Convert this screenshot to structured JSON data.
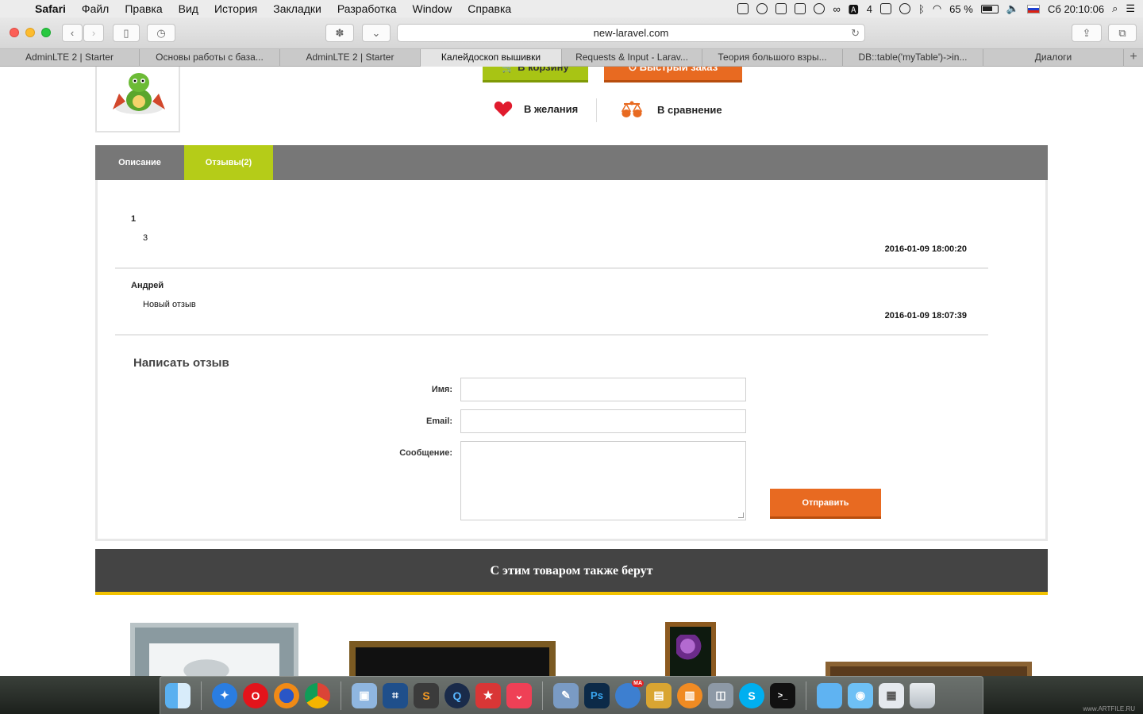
{
  "menubar": {
    "app": "Safari",
    "items": [
      "Файл",
      "Правка",
      "Вид",
      "История",
      "Закладки",
      "Разработка",
      "Window",
      "Справка"
    ],
    "status": {
      "num": "4",
      "battery": "65 %",
      "clock": "Сб 20:10:06"
    }
  },
  "browser": {
    "address": "new-laravel.com",
    "tabs": [
      {
        "label": "AdminLTE 2 | Starter"
      },
      {
        "label": "Основы работы с база..."
      },
      {
        "label": "AdminLTE 2 | Starter"
      },
      {
        "label": "Калейдоскоп вышивки"
      },
      {
        "label": "Requests & Input - Larav..."
      },
      {
        "label": "Теория большого взры..."
      },
      {
        "label": "DB::table('myTable')->in..."
      },
      {
        "label": "Диалоги"
      }
    ],
    "add_tab": "+"
  },
  "product": {
    "cart_button": "В корзину",
    "quick_order_button": "Быстрый заказ",
    "wishlist": "В желания",
    "compare": "В сравнение"
  },
  "product_tabs": {
    "description": "Описание",
    "reviews": "Отзывы(2)"
  },
  "reviews": [
    {
      "author": "1",
      "text": "3",
      "date": "2016-01-09 18:00:20"
    },
    {
      "author": "Андрей",
      "text": "Новый отзыв",
      "date": "2016-01-09 18:07:39"
    }
  ],
  "review_form": {
    "title": "Написать отзыв",
    "name_label": "Имя:",
    "email_label": "Email:",
    "message_label": "Сообщение:",
    "name_value": "",
    "email_value": "",
    "message_value": "",
    "submit": "Отправить"
  },
  "also_bought": {
    "title": "С этим товаром также берут"
  },
  "dock": {
    "apps": [
      "finder-icon",
      "safari-icon",
      "opera-icon",
      "firefox-icon",
      "chrome-icon",
      "virtualbox-icon",
      "sourcetree-icon",
      "sublime-text-icon",
      "quicktime-icon",
      "wunderlist-icon",
      "pocket-icon",
      "preview-icon",
      "photoshop-icon",
      "mail-ru-agent-icon",
      "sequel-pro-icon",
      "ibooks-icon",
      "image-capture-icon",
      "skype-icon",
      "terminal-icon"
    ],
    "folders": [
      "folder-icon",
      "screenshots-folder-icon",
      "downloads-stack-icon",
      "trash-icon"
    ],
    "badge": "MA",
    "watermark": "www.ARTFILE.RU"
  },
  "colors": {
    "accent_orange": "#e86a21",
    "accent_green": "#b5cc18",
    "tab_bar": "#777777",
    "header_dark": "#444444",
    "header_underline": "#f2c200"
  }
}
